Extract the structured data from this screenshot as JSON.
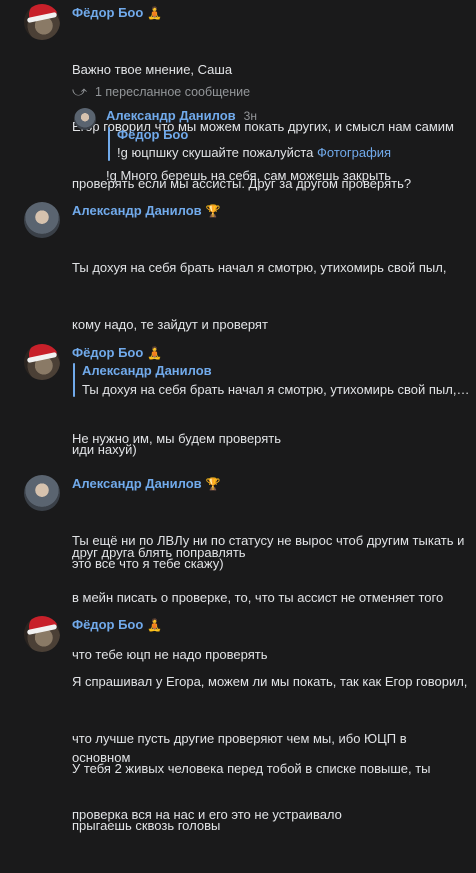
{
  "messages": [
    {
      "author": "Фёдор Боо",
      "badge": "🧘",
      "lines": [
        "Важно твое мнение, Саша",
        "Егор говорил что мы можем покать других, и смысл нам самим",
        "проверять если мы ассисты. Друг за другом проверять?"
      ],
      "forwarded_label": "1 пересланное сообщение",
      "forwarded": {
        "author": "Александр Данилов",
        "time": "3н",
        "quote_author": "Фёдор Боо",
        "quote_text": "!g юцпшку скушайте пожалуйста",
        "quote_link": "Фотография",
        "reply": "!g Много берешь на себя, сам можешь закрыть"
      }
    },
    {
      "author": "Александр Данилов",
      "badge": "🏆",
      "lines": [
        "Ты дохуя на себя брать начал я смотрю, утихомирь свой пыл,",
        "кому надо, те зайдут и проверят",
        "",
        "Не нужно им, мы будем проверять",
        "",
        "друг друга блять поправлять"
      ]
    },
    {
      "author": "Фёдор Боо",
      "badge": "🧘",
      "quote_author": "Александр Данилов",
      "quote_text": "Ты дохуя на себя брать начал я смотрю, утихомирь свой пыл, к...",
      "lines": [
        "иди нахуй)",
        "",
        "это все что я тебе скажу)"
      ]
    },
    {
      "author": "Александр Данилов",
      "badge": "🏆",
      "lines": [
        "Ты ещё ни по ЛВЛу ни по статусу не вырос чтоб другим тыкать и",
        "в мейн писать о проверке, то, что ты ассист не отменяет того",
        "что тебе юцп не надо проверять",
        "",
        "У тебя 2 живых человека перед тобой в списке повыше, ты",
        "прыгаешь сквозь головы"
      ]
    },
    {
      "author": "Фёдор Боо",
      "badge": "🧘",
      "lines": [
        "Я спрашивал у Егора, можем ли мы покать, так как Егор говорил,",
        "что лучше пусть другие проверяют чем мы, ибо ЮЦП в основном",
        "проверка вся на нас и его это не устраивало"
      ]
    }
  ]
}
